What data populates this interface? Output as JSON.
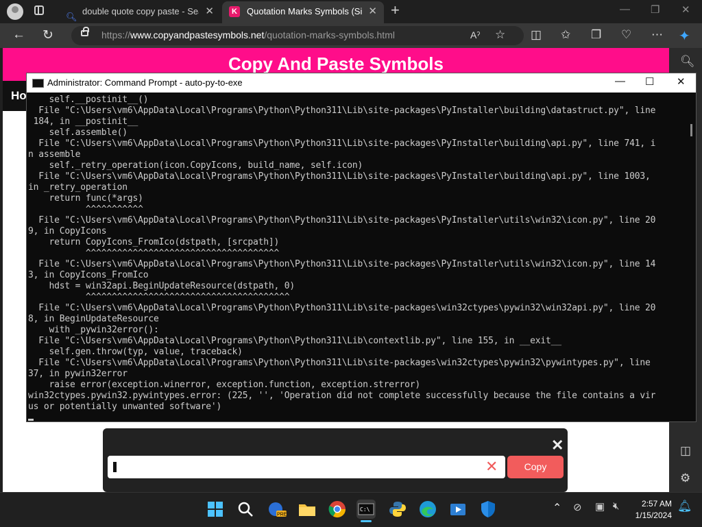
{
  "browser": {
    "tabs": [
      {
        "label": "double quote copy paste - Searc",
        "active": false
      },
      {
        "label": "Quotation Marks Symbols (Simpl",
        "active": true
      }
    ],
    "new_tab_glyph": "+",
    "close_glyph": "✕",
    "address": {
      "prefix": "https://",
      "domain": "www.copyandpastesymbols.net",
      "path": "/quotation-marks-symbols.html"
    }
  },
  "page": {
    "site_title": "Copy And Paste Symbols",
    "nav_first": "Ho",
    "copybar": {
      "copy_label": "Copy",
      "input_value": ""
    }
  },
  "cmd": {
    "title": "Administrator: Command Prompt - auto-py-to-exe",
    "lines": [
      "    self.__postinit__()",
      "  File \"C:\\Users\\vm6\\AppData\\Local\\Programs\\Python\\Python311\\Lib\\site-packages\\PyInstaller\\building\\datastruct.py\", line",
      " 184, in __postinit__",
      "    self.assemble()",
      "  File \"C:\\Users\\vm6\\AppData\\Local\\Programs\\Python\\Python311\\Lib\\site-packages\\PyInstaller\\building\\api.py\", line 741, i",
      "n assemble",
      "    self._retry_operation(icon.CopyIcons, build_name, self.icon)",
      "  File \"C:\\Users\\vm6\\AppData\\Local\\Programs\\Python\\Python311\\Lib\\site-packages\\PyInstaller\\building\\api.py\", line 1003,",
      "in _retry_operation",
      "    return func(*args)",
      "           ^^^^^^^^^^^",
      "  File \"C:\\Users\\vm6\\AppData\\Local\\Programs\\Python\\Python311\\Lib\\site-packages\\PyInstaller\\utils\\win32\\icon.py\", line 20",
      "9, in CopyIcons",
      "    return CopyIcons_FromIco(dstpath, [srcpath])",
      "           ^^^^^^^^^^^^^^^^^^^^^^^^^^^^^^^^^^^^^",
      "  File \"C:\\Users\\vm6\\AppData\\Local\\Programs\\Python\\Python311\\Lib\\site-packages\\PyInstaller\\utils\\win32\\icon.py\", line 14",
      "3, in CopyIcons_FromIco",
      "    hdst = win32api.BeginUpdateResource(dstpath, 0)",
      "           ^^^^^^^^^^^^^^^^^^^^^^^^^^^^^^^^^^^^^^^",
      "  File \"C:\\Users\\vm6\\AppData\\Local\\Programs\\Python\\Python311\\Lib\\site-packages\\win32ctypes\\pywin32\\win32api.py\", line 20",
      "8, in BeginUpdateResource",
      "    with _pywin32error():",
      "  File \"C:\\Users\\vm6\\AppData\\Local\\Programs\\Python\\Python311\\Lib\\contextlib.py\", line 155, in __exit__",
      "    self.gen.throw(typ, value, traceback)",
      "  File \"C:\\Users\\vm6\\AppData\\Local\\Programs\\Python\\Python311\\Lib\\site-packages\\win32ctypes\\pywin32\\pywintypes.py\", line",
      "37, in pywin32error",
      "    raise error(exception.winerror, exception.function, exception.strerror)",
      "win32ctypes.pywin32.pywintypes.error: (225, '', 'Operation did not complete successfully because the file contains a vir",
      "us or potentially unwanted software')"
    ]
  },
  "taskbar": {
    "time": "2:57 AM",
    "date": "1/15/2024",
    "apps": [
      "windows-start-icon",
      "search-icon",
      "folder-pre-icon",
      "file-explorer-icon",
      "chrome-icon",
      "terminal-icon",
      "python-icon",
      "edge-icon",
      "media-icon",
      "defender-icon"
    ]
  },
  "colors": {
    "brand_pink": "#ff0d8a",
    "copy_button": "#f25c5c",
    "console_bg": "#0c0c0c"
  }
}
